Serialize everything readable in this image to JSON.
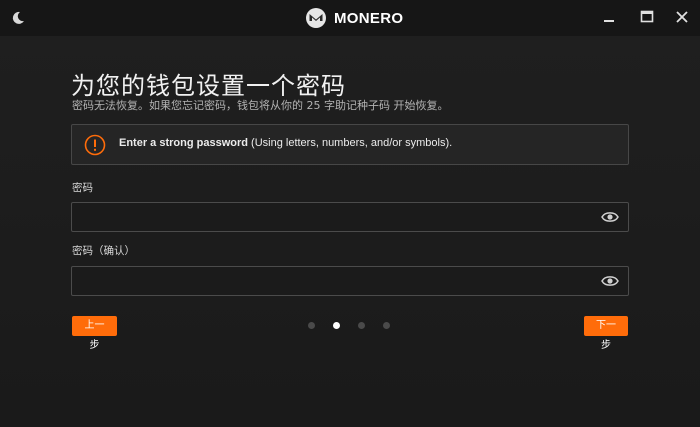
{
  "app": {
    "brand_name": "MONERO",
    "theme_icon": "moon-icon",
    "logo_icon": "monero-logo-icon",
    "window_controls": [
      "minimize-icon",
      "maximize-icon",
      "close-icon"
    ]
  },
  "page": {
    "title": "为您的钱包设置一个密码",
    "subtitle": "密码无法恢复。如果您忘记密码，钱包将从你的 25 字助记种子码 开始恢复。"
  },
  "notice": {
    "icon": "warning-icon",
    "bold_text": "Enter a strong password",
    "rest_text": " (Using letters, numbers, and/or symbols)."
  },
  "fields": {
    "password": {
      "label": "密码",
      "value": "",
      "icon": "eye-icon"
    },
    "confirm": {
      "label": "密码（确认）",
      "value": "",
      "icon": "eye-icon"
    }
  },
  "nav": {
    "prev_label": "上一步",
    "next_label": "下一步",
    "steps_total": 4,
    "current_step": 2
  },
  "colors": {
    "accent": "#ff6c0a",
    "background": "#1c1c1c",
    "titlebar": "#161616"
  }
}
